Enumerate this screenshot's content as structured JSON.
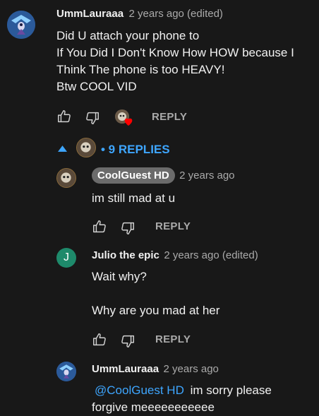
{
  "comment": {
    "author": "UmmLauraaa",
    "meta": "2 years ago (edited)",
    "text": "Did U attach your phone to\nIf You Did I Don't Know How HOW because I\nThink The phone is too HEAVY!\nBtw COOL VID",
    "reply_label": "REPLY"
  },
  "replies_toggle": {
    "label": "• 9 REPLIES"
  },
  "replies": [
    {
      "author": "CoolGuest HD",
      "meta": "2 years ago",
      "text": "im still mad at u",
      "reply_label": "REPLY"
    },
    {
      "author": "Julio the epic",
      "avatar_letter": "J",
      "meta": "2 years ago (edited)",
      "text": "Wait why?\n\nWhy are you mad at her",
      "reply_label": "REPLY"
    },
    {
      "author": "UmmLauraaa",
      "meta": "2 years ago",
      "mention": "@CoolGuest HD",
      "text": " im sorry please",
      "text2": "forgive meeeeeeeeeee"
    }
  ],
  "colors": {
    "background": "#181818",
    "link": "#3ea6ff",
    "heart": "#ff0000",
    "julio_avatar": "#1e8a6b"
  }
}
